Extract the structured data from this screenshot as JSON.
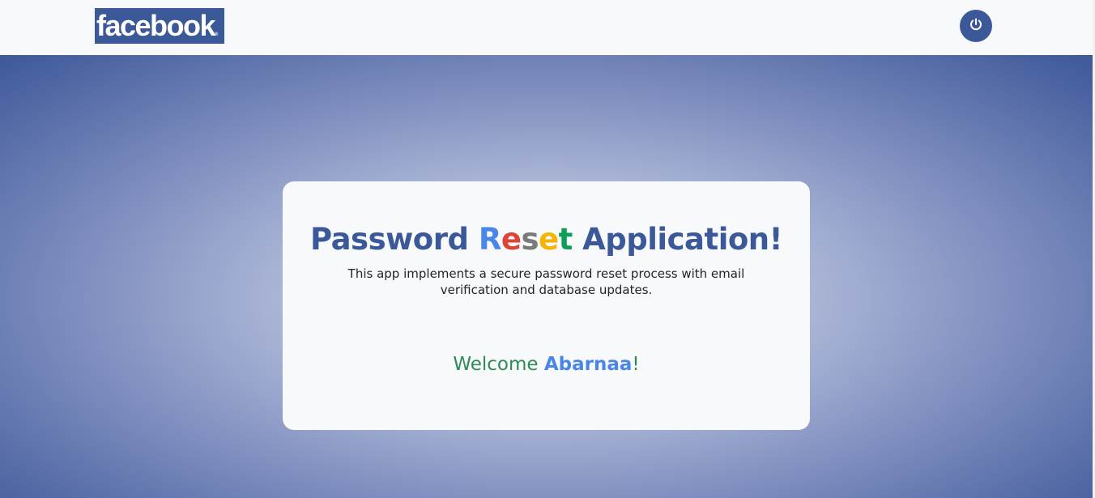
{
  "navbar": {
    "logo_text": "facebook",
    "logo_mark": "®",
    "logout_icon": "power-icon",
    "colors": {
      "background": "#f8f9fa",
      "brand": "#3b5998"
    }
  },
  "card": {
    "title_part1": "Password ",
    "title_reset_letters": [
      "R",
      "e",
      "s",
      "e",
      "t"
    ],
    "title_reset_colors": [
      "#4a86e8",
      "#db4437",
      "#7a7a7a",
      "#f4b400",
      "#0f9d58"
    ],
    "title_part2": " Application!",
    "description": "This app implements a secure password reset process with email verification and database updates.",
    "welcome_prefix": "Welcome ",
    "welcome_name": "Abarnaa",
    "welcome_suffix": "!",
    "colors": {
      "title": "#3b5998",
      "welcome": "#2e8b57",
      "name": "#4a86e8"
    }
  }
}
